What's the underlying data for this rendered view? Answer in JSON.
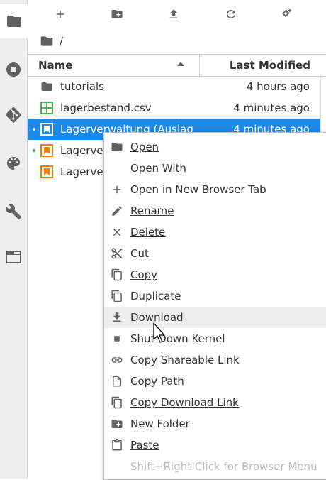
{
  "breadcrumb": {
    "path": "/"
  },
  "header": {
    "name": "Name",
    "last_modified": "Last Modified"
  },
  "files": [
    {
      "name": "tutorials",
      "modified": "4 hours ago"
    },
    {
      "name": "lagerbestand.csv",
      "modified": "4 minutes ago"
    },
    {
      "name": "Lagerverwaltung (Auslag",
      "modified": "4 minutes ago"
    },
    {
      "name": "Lagerver",
      "modified": ""
    },
    {
      "name": "Lagerver",
      "modified": ""
    }
  ],
  "menu": {
    "open": "Open",
    "open_with": "Open With",
    "open_new_tab": "Open in New Browser Tab",
    "rename": "Rename",
    "delete": "Delete",
    "cut": "Cut",
    "copy": "Copy",
    "duplicate": "Duplicate",
    "download": "Download",
    "shutdown_kernel": "Shut Down Kernel",
    "copy_shareable": "Copy Shareable Link",
    "copy_path": "Copy Path",
    "copy_download": "Copy Download Link",
    "new_folder": "New Folder",
    "paste": "Paste",
    "browser_menu_hint": "Shift+Right Click for Browser Menu"
  },
  "colors": {
    "selection": "#1e88e5",
    "notebook_icon": "#f57c00",
    "csv_icon": "#4caf50",
    "running_dot": "#4caf50"
  }
}
